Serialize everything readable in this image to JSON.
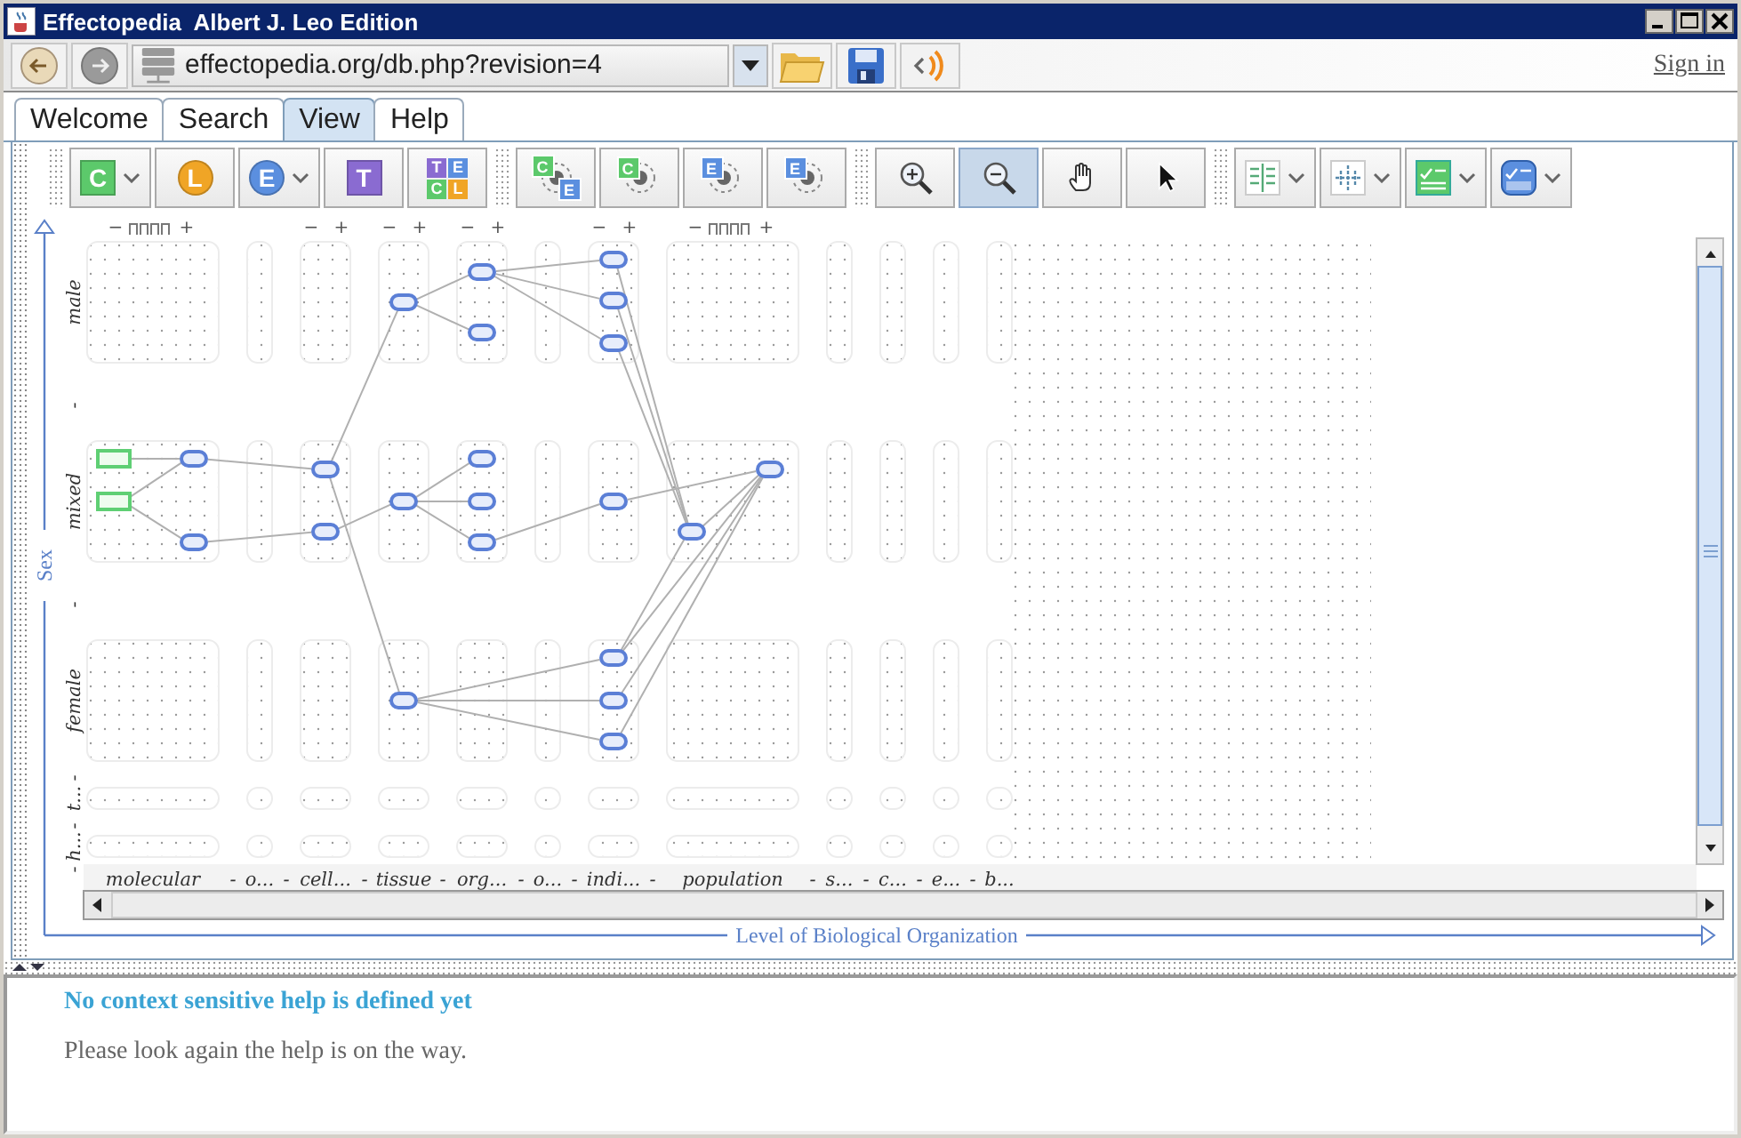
{
  "window": {
    "title": "Effectopedia  Albert J. Leo Edition"
  },
  "address_bar": {
    "url": "effectopedia.org/db.php?revision=4",
    "sign_in": "Sign in"
  },
  "tabs": [
    {
      "label": "Welcome",
      "selected": false
    },
    {
      "label": "Search",
      "selected": false
    },
    {
      "label": "View",
      "selected": true
    },
    {
      "label": "Help",
      "selected": false
    }
  ],
  "toolbar": {
    "groups": [
      [
        {
          "kind": "square",
          "letters": [
            {
              "text": "C",
              "color": "#5cc96b"
            }
          ],
          "dropdown": true
        },
        {
          "kind": "circle",
          "letters": [
            {
              "text": "L",
              "color": "#f0a526"
            }
          ],
          "dropdown": false
        },
        {
          "kind": "circle",
          "letters": [
            {
              "text": "E",
              "color": "#5b8fdf"
            }
          ],
          "dropdown": true
        },
        {
          "kind": "square",
          "letters": [
            {
              "text": "T",
              "color": "#8a6bd1"
            }
          ],
          "dropdown": false
        },
        {
          "kind": "grid",
          "letters": [
            {
              "text": "T",
              "color": "#8a6bd1"
            },
            {
              "text": "E",
              "color": "#5b8fdf"
            },
            {
              "text": "C",
              "color": "#5cc96b"
            },
            {
              "text": "L",
              "color": "#f0a526"
            }
          ],
          "dropdown": false
        }
      ],
      [
        {
          "kind": "link",
          "letters": [
            {
              "text": "C",
              "color": "#5cc96b"
            },
            {
              "text": "E",
              "color": "#5b8fdf"
            }
          ],
          "dropdown": false
        },
        {
          "kind": "link",
          "letters": [
            {
              "text": "C",
              "color": "#5cc96b"
            }
          ],
          "dropdown": false
        },
        {
          "kind": "link",
          "letters": [
            {
              "text": "E",
              "color": "#5b8fdf"
            }
          ],
          "dropdown": false
        },
        {
          "kind": "link",
          "letters": [
            {
              "text": "E",
              "color": "#5b8fdf"
            }
          ],
          "dropdown": false
        }
      ],
      [
        {
          "kind": "zoom-in",
          "selected": false
        },
        {
          "kind": "zoom-out",
          "selected": true
        },
        {
          "kind": "pan",
          "selected": false
        },
        {
          "kind": "pointer",
          "selected": false
        }
      ],
      [
        {
          "kind": "layout",
          "dropdown": true
        },
        {
          "kind": "spread",
          "dropdown": true
        },
        {
          "kind": "validate",
          "dropdown": true
        },
        {
          "kind": "report",
          "dropdown": true
        }
      ]
    ]
  },
  "canvas": {
    "y_axis": "Sex",
    "x_axis": "Level of Biological Organization",
    "rows": [
      {
        "label": "male",
        "kind": "expanded",
        "separator": "-"
      },
      {
        "label": "mixed",
        "kind": "expanded",
        "separator": "-"
      },
      {
        "label": "female",
        "kind": "expanded",
        "separator": "-"
      },
      {
        "label": "t...",
        "kind": "collapsed",
        "separator": "-"
      },
      {
        "label": "h...",
        "kind": "collapsed",
        "separator": "-"
      }
    ],
    "columns": [
      {
        "label": "molecular",
        "kind": "wide",
        "separator": "-",
        "zoom_out": "−",
        "zoom_in": "+"
      },
      {
        "label": "o...",
        "kind": "narrow",
        "separator": "-"
      },
      {
        "label": "cell...",
        "kind": "medium",
        "separator": "-",
        "zoom_out": "−",
        "zoom_in": "+"
      },
      {
        "label": "tissue",
        "kind": "medium",
        "separator": "-",
        "zoom_out": "−",
        "zoom_in": "+"
      },
      {
        "label": "org...",
        "kind": "medium",
        "separator": "-",
        "zoom_out": "−",
        "zoom_in": "+"
      },
      {
        "label": "o...",
        "kind": "narrow",
        "separator": "-"
      },
      {
        "label": "indi...",
        "kind": "medium",
        "separator": "-",
        "zoom_out": "−",
        "zoom_in": "+"
      },
      {
        "label": "population",
        "kind": "wide",
        "separator": "-",
        "zoom_out": "−",
        "zoom_in": "+"
      },
      {
        "label": "s...",
        "kind": "narrow",
        "separator": "-"
      },
      {
        "label": "c...",
        "kind": "narrow",
        "separator": "-"
      },
      {
        "label": "e...",
        "kind": "narrow",
        "separator": "-"
      },
      {
        "label": "b...",
        "kind": "narrow"
      }
    ]
  },
  "help": {
    "title": "No context sensitive help is defined yet",
    "text": "Please look again the help is on the way."
  }
}
